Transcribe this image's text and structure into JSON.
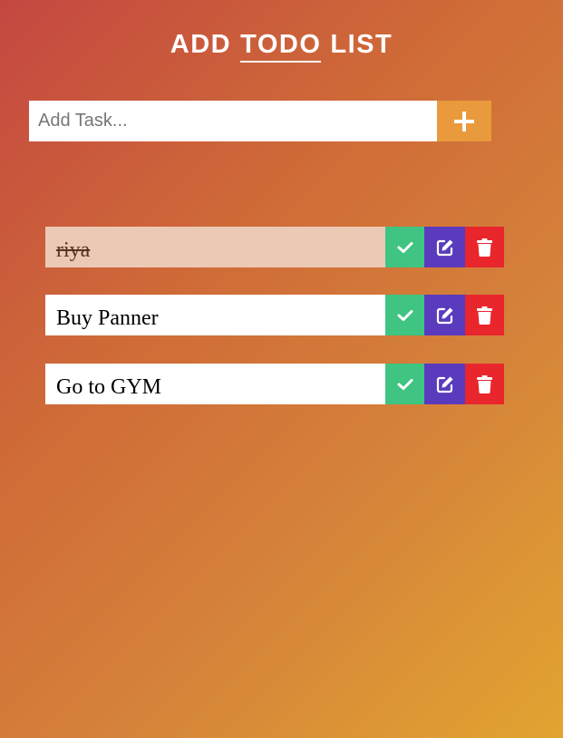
{
  "header": {
    "title_left": "ADD",
    "title_mid": "TODO",
    "title_right": "LIST"
  },
  "add_task": {
    "placeholder": "Add Task...",
    "value": "",
    "add_icon": "plus-icon"
  },
  "todos": [
    {
      "text": "riya",
      "completed": true
    },
    {
      "text": "Buy Panner",
      "completed": false
    },
    {
      "text": "Go to GYM",
      "completed": false
    }
  ],
  "icons": {
    "complete": "check-icon",
    "edit": "edit-icon",
    "delete": "trash-icon"
  },
  "colors": {
    "add_button": "#e99a3c",
    "complete_button": "#3fc482",
    "edit_button": "#5a3bbd",
    "delete_button": "#e9262c",
    "completed_task_background": "#ebc9b5"
  }
}
